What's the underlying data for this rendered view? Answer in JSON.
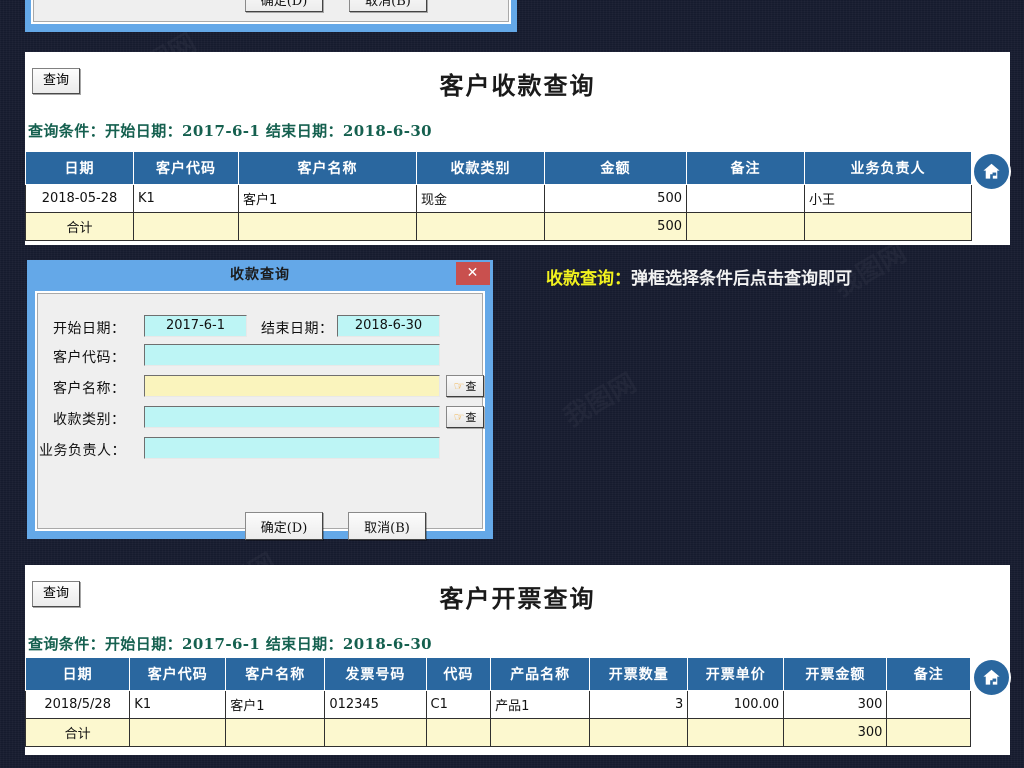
{
  "background": {
    "color": "#161b2e",
    "watermarks": [
      "我图网",
      "WWW.OOOPIC.COM",
      "我图网",
      "我图网",
      "我图网",
      "我图网"
    ]
  },
  "colors": {
    "header_blue": "#2a679f",
    "total_row_yellow": "#fcf8cf",
    "condition_green": "#15604f",
    "dialog_titlebar": "#64a8e8",
    "dialog_close": "#c9504e",
    "input_cyan": "#bdf5f5",
    "input_yellow": "#faf4bd",
    "note_highlight": "#f2f21e",
    "note_text": "#f2f2f2"
  },
  "top_dialog": {
    "name": "partial-dialog-top",
    "ok_label": "确定(D)",
    "cancel_label": "取消(B)"
  },
  "report_receipt": {
    "query_button": "查询",
    "title": "客户收款查询",
    "condition": "查询条件：开始日期：2017-6-1 结束日期：2018-6-30",
    "home_icon": "home-icon",
    "columns": [
      "日期",
      "客户代码",
      "客户名称",
      "收款类别",
      "金额",
      "备注",
      "业务负责人"
    ],
    "rows": [
      [
        "2018-05-28",
        "K1",
        "客户1",
        "现金",
        "500",
        "",
        "小王"
      ]
    ],
    "total_label": "合计",
    "total_row": [
      "合计",
      "",
      "",
      "",
      "500",
      "",
      ""
    ]
  },
  "annotation": {
    "highlight": "收款查询：",
    "text": "弹框选择条件后点击查询即可"
  },
  "dialog": {
    "title": "收款查询",
    "close_label": "✕",
    "fields": [
      {
        "label": "开始日期：",
        "value": "2017-6-1"
      },
      {
        "label": "结束日期：",
        "value": "2018-6-30"
      },
      {
        "label": "客户代码：",
        "value": ""
      },
      {
        "label": "客户名称：",
        "value": ""
      },
      {
        "label": "收款类别：",
        "value": ""
      },
      {
        "label": "业务负责人：",
        "value": ""
      }
    ],
    "pick_button_label": "查",
    "ok_label": "确定(D)",
    "cancel_label": "取消(B)"
  },
  "report_invoice": {
    "query_button": "查询",
    "title": "客户开票查询",
    "condition": "查询条件：开始日期：2017-6-1 结束日期：2018-6-30",
    "home_icon": "home-icon",
    "columns": [
      "日期",
      "客户代码",
      "客户名称",
      "发票号码",
      "代码",
      "产品名称",
      "开票数量",
      "开票单价",
      "开票金额",
      "备注"
    ],
    "rows": [
      [
        "2018/5/28",
        "K1",
        "客户1",
        "012345",
        "C1",
        "产品1",
        "3",
        "100.00",
        "300",
        ""
      ]
    ],
    "total_label": "合计",
    "total_row": [
      "合计",
      "",
      "",
      "",
      "",
      "",
      "",
      "",
      "300",
      ""
    ]
  }
}
